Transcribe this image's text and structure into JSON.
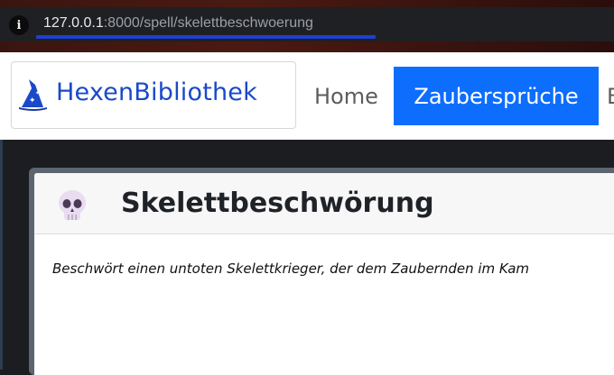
{
  "browser": {
    "url_host": "127.0.0.1",
    "url_rest": ":8000/spell/skelettbeschwoerung",
    "info_symbol": "i"
  },
  "navbar": {
    "brand_name": "HexenBibliothek",
    "items": [
      {
        "label": "Home"
      },
      {
        "label": "Zaubersprüche",
        "active": true
      },
      {
        "label": "B"
      }
    ],
    "accent_color": "#0d6efd"
  },
  "spell": {
    "title": "Skelettbeschwörung",
    "icon": "skull-icon",
    "description": "Beschwört einen untoten Skelettkrieger, der dem Zaubernden im Kam"
  }
}
